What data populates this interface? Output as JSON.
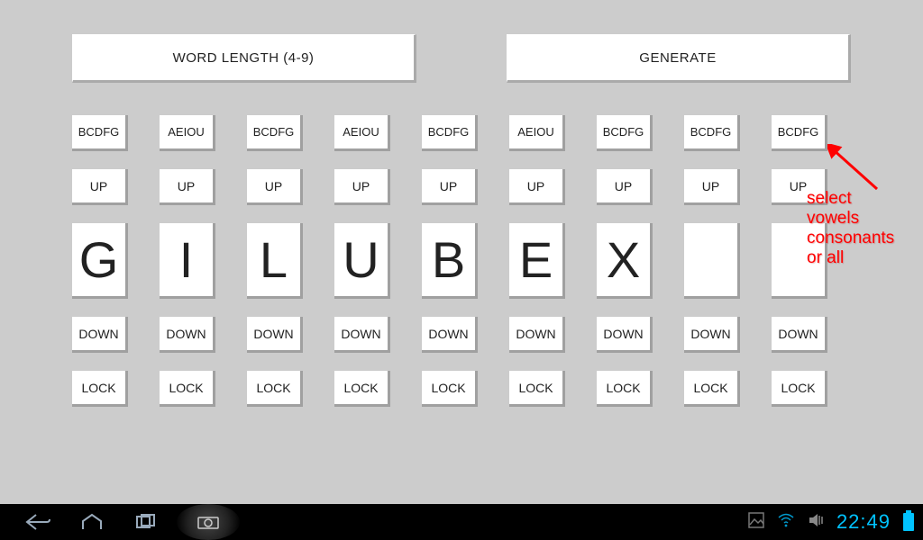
{
  "header": {
    "word_length_label": "WORD LENGTH (4-9)",
    "generate_label": "GENERATE"
  },
  "columns": [
    {
      "mode": "BCDFG",
      "up": "UP",
      "letter": "G",
      "down": "DOWN",
      "lock": "LOCK"
    },
    {
      "mode": "AEIOU",
      "up": "UP",
      "letter": "I",
      "down": "DOWN",
      "lock": "LOCK"
    },
    {
      "mode": "BCDFG",
      "up": "UP",
      "letter": "L",
      "down": "DOWN",
      "lock": "LOCK"
    },
    {
      "mode": "AEIOU",
      "up": "UP",
      "letter": "U",
      "down": "DOWN",
      "lock": "LOCK"
    },
    {
      "mode": "BCDFG",
      "up": "UP",
      "letter": "B",
      "down": "DOWN",
      "lock": "LOCK"
    },
    {
      "mode": "AEIOU",
      "up": "UP",
      "letter": "E",
      "down": "DOWN",
      "lock": "LOCK"
    },
    {
      "mode": "BCDFG",
      "up": "UP",
      "letter": "X",
      "down": "DOWN",
      "lock": "LOCK"
    },
    {
      "mode": "BCDFG",
      "up": "UP",
      "letter": "",
      "down": "DOWN",
      "lock": "LOCK"
    },
    {
      "mode": "BCDFG",
      "up": "UP",
      "letter": "",
      "down": "DOWN",
      "lock": "LOCK"
    }
  ],
  "annotation": {
    "line1": "select",
    "line2": "vowels",
    "line3": "consonants",
    "line4": "or all"
  },
  "statusbar": {
    "time": "22:49"
  }
}
